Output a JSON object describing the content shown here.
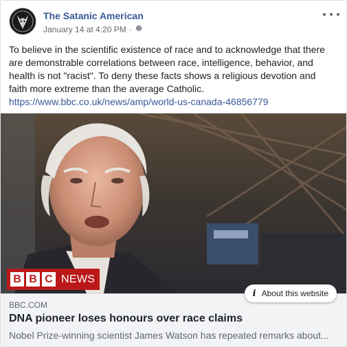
{
  "post": {
    "page_name": "The Satanic American",
    "timestamp": "January 14 at 4:20 PM",
    "separator": "·",
    "privacy_icon": "gear-icon",
    "avatar_icon": "goat-head-logo",
    "text": "To believe in the scientific existence of race and to acknowledge that there are demonstrable correlations between race, intelligence, behavior, and health is not \"racist\". To deny these facts shows a religious devotion and faith more extreme than the average Catholic.",
    "link_text": "https://www.bbc.co.uk/news/amp/world-us-canada-46856779"
  },
  "link_preview": {
    "watermark_blocks": [
      "B",
      "B",
      "C"
    ],
    "watermark_word": "NEWS",
    "about_label": "About this website",
    "about_icon": "info-icon",
    "domain": "BBC.COM",
    "title": "DNA pioneer loses honours over race claims",
    "description": "Nobel Prize-winning scientist James Watson has repeated remarks about..."
  },
  "colors": {
    "link_blue": "#385898",
    "bbc_red": "#bb1919",
    "meta_gray": "#606770",
    "preview_bg": "#f2f3f5"
  }
}
